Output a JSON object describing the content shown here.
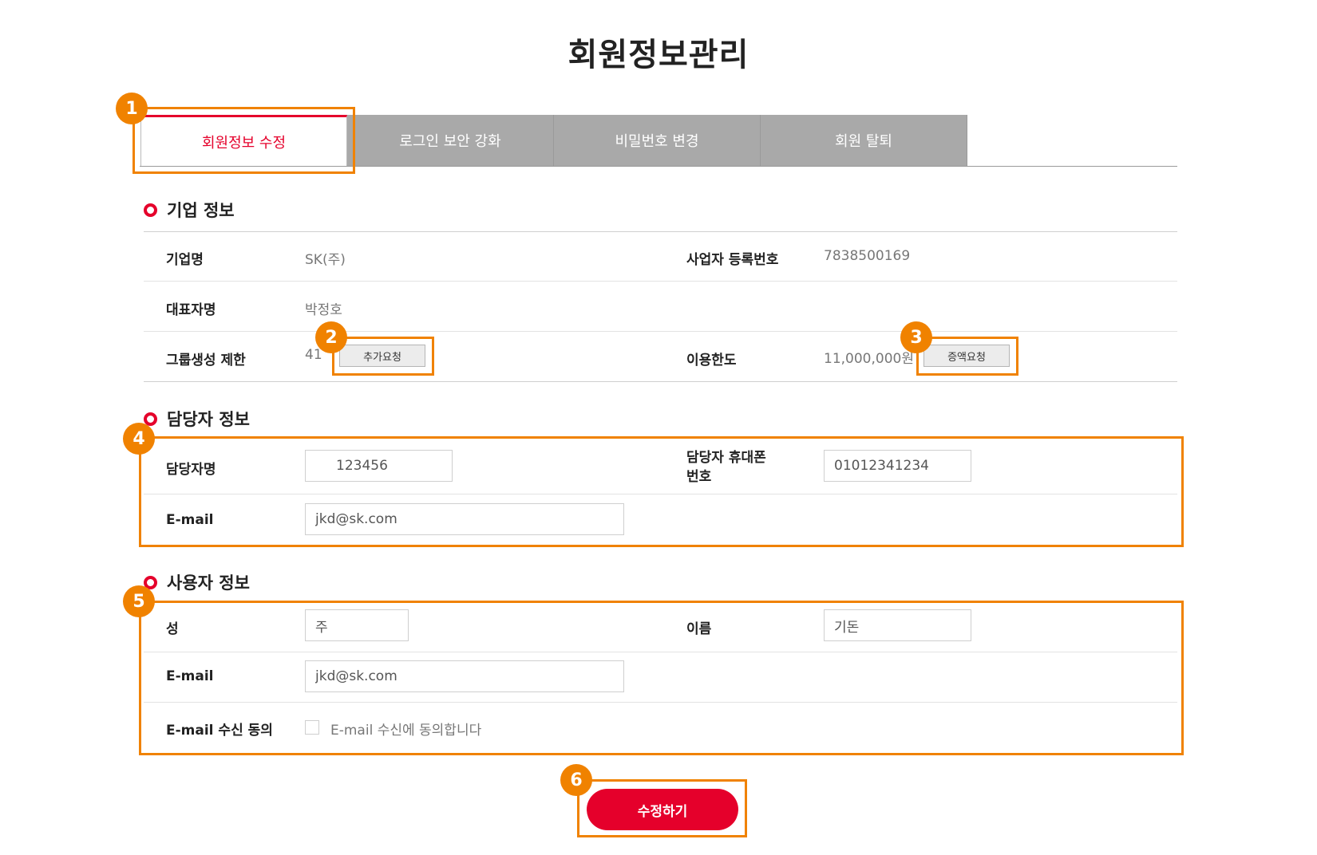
{
  "page": {
    "title": "회원정보관리"
  },
  "tabs": [
    {
      "label": "회원정보 수정",
      "active": true
    },
    {
      "label": "로그인 보안 강화",
      "active": false
    },
    {
      "label": "비밀번호 변경",
      "active": false
    },
    {
      "label": "회원 탈퇴",
      "active": false
    }
  ],
  "company": {
    "section_title": "기업 정보",
    "name_label": "기업명",
    "name_value": "SK(주)",
    "bizno_label": "사업자 등록번호",
    "bizno_value": "7838500169",
    "ceo_label": "대표자명",
    "ceo_value": "박정호",
    "group_label": "그룹생성 제한",
    "group_value": "41",
    "group_button": "추가요청",
    "limit_label": "이용한도",
    "limit_value": "11,000,000원",
    "limit_button": "증액요청"
  },
  "manager": {
    "section_title": "담당자 정보",
    "name_label": "담당자명",
    "name_value": "123456",
    "phone_label_line1": "담당자 휴대폰",
    "phone_label_line2": "번호",
    "phone_value": "01012341234",
    "email_label": "E-mail",
    "email_value": "jkd@sk.com"
  },
  "user": {
    "section_title": "사용자 정보",
    "last_name_label": "성",
    "last_name_value": "주",
    "first_name_label": "이름",
    "first_name_value": "기돈",
    "email_label": "E-mail",
    "email_value": "jkd@sk.com",
    "consent_label": "E-mail 수신 동의",
    "consent_text": "E-mail 수신에 동의합니다",
    "consent_checked": false
  },
  "submit_label": "수정하기",
  "annotations": {
    "badges": [
      "1",
      "2",
      "3",
      "4",
      "5",
      "6"
    ],
    "color": "#f08200"
  },
  "colors": {
    "accent": "#e5002b",
    "tab_inactive": "#a9a9a9"
  }
}
